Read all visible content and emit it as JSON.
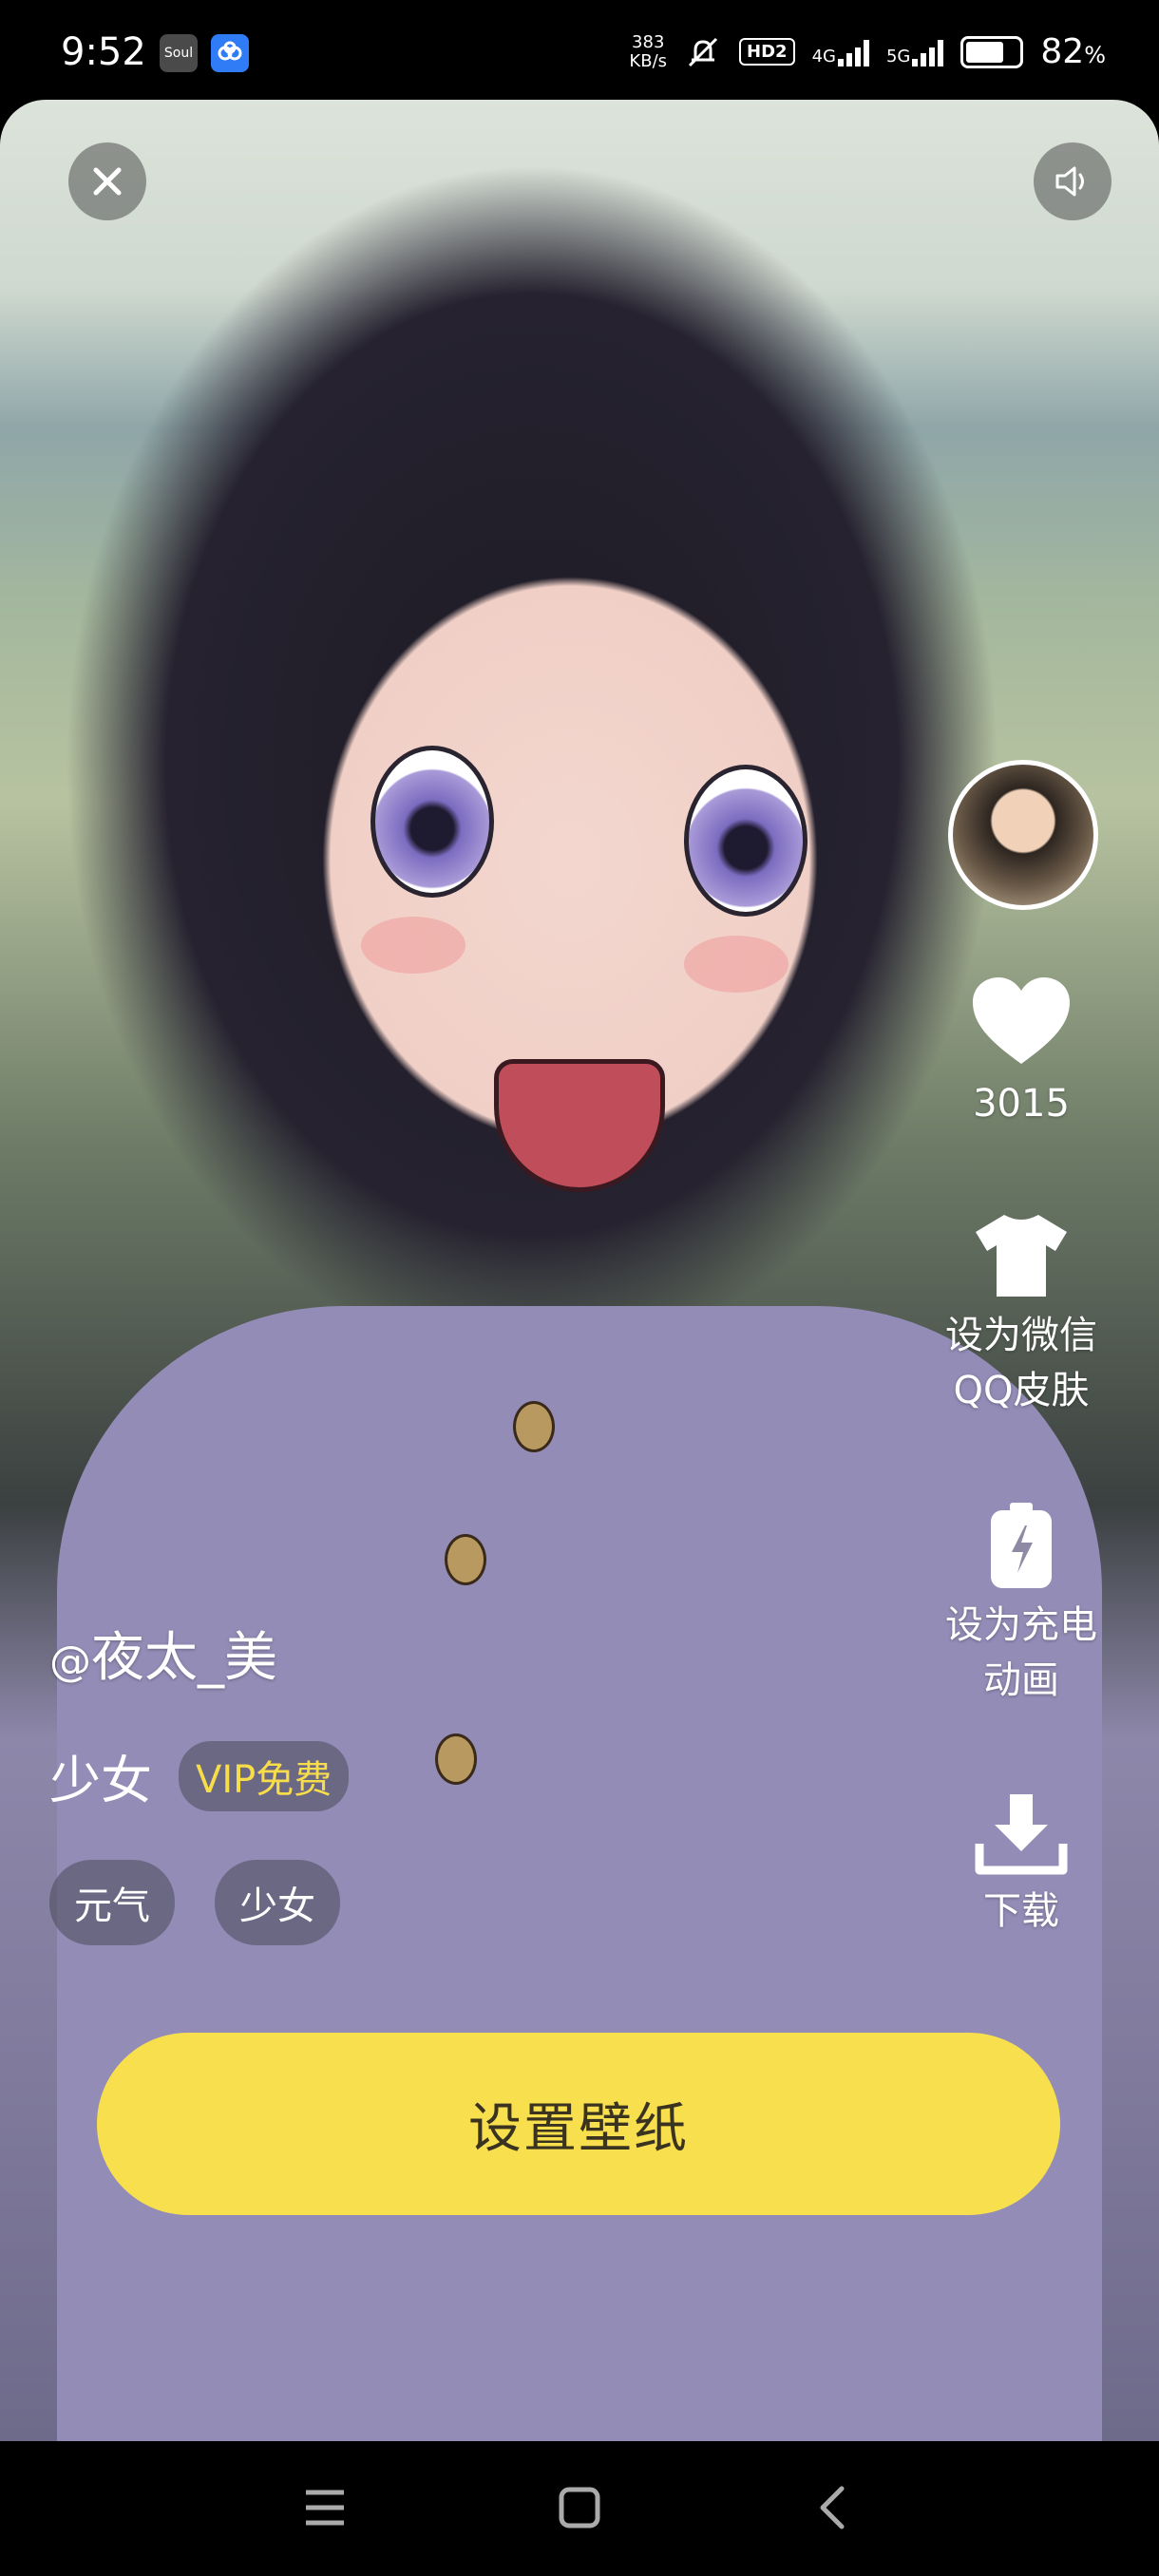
{
  "status_bar": {
    "time": "9:52",
    "apps": [
      {
        "name": "Soul",
        "icon": "soul-app-icon",
        "color": "#4a4a4a"
      },
      {
        "name": "baidu-netdisk",
        "icon": "cloud-app-icon",
        "color": "#2f7cf6"
      }
    ],
    "speed_value": "383",
    "speed_unit": "KB/s",
    "hd_label": "HD2",
    "net_4g": "4G",
    "net_5g": "5G",
    "battery": "82",
    "battery_unit": "%",
    "battery_level": 0.82
  },
  "controls": {
    "close_icon": "close-icon",
    "sound_icon": "speaker-icon"
  },
  "actions": {
    "like_count": "3015",
    "skin_line1": "设为微信",
    "skin_line2": "QQ皮肤",
    "charge_line1": "设为充电",
    "charge_line2": "动画",
    "download": "下载"
  },
  "info": {
    "author_at": "@",
    "author_name": "夜太_美",
    "title": "少女",
    "vip_badge": "VIP免费",
    "tags": [
      "元气",
      "少女"
    ]
  },
  "set_wallpaper_label": "设置壁纸",
  "colors": {
    "accent_yellow": "#f8df4e",
    "vip_gold": "#f8dd4a"
  }
}
